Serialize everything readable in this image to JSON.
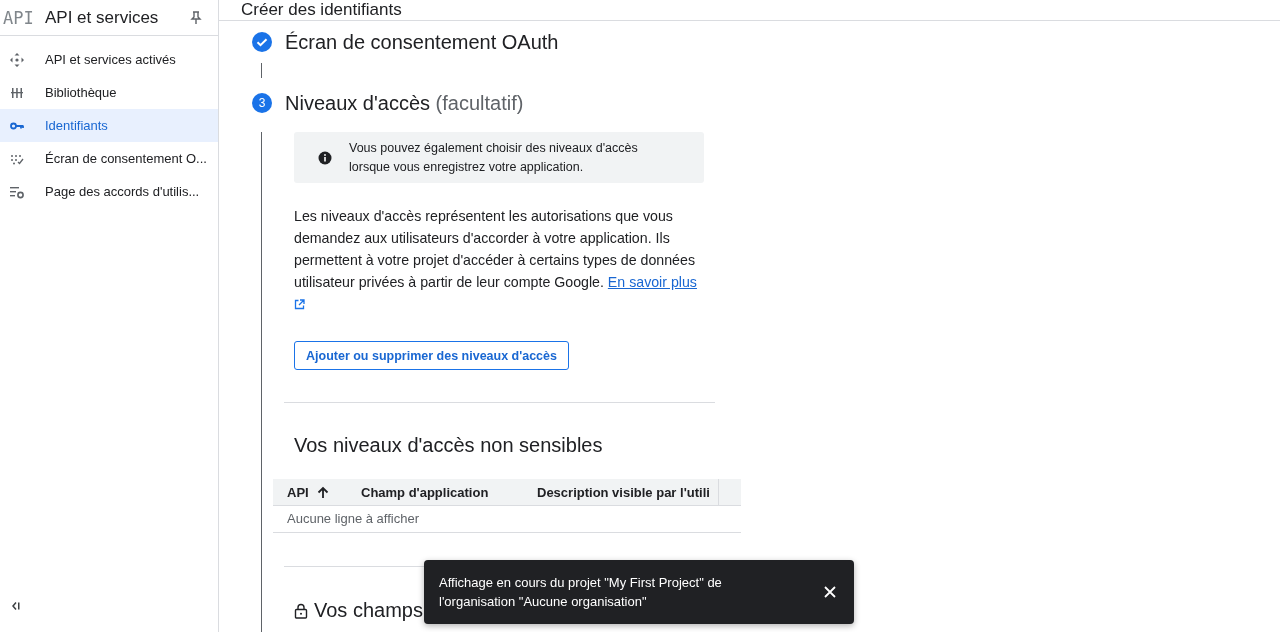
{
  "app": {
    "logo": "API",
    "title": "API et services"
  },
  "page_title": "Créer des identifiants",
  "sidebar": {
    "items": [
      {
        "label": "API et services activés",
        "kind": "move",
        "selected": false
      },
      {
        "label": "Bibliothèque",
        "kind": "library",
        "selected": false
      },
      {
        "label": "Identifiants",
        "kind": "key",
        "selected": true
      },
      {
        "label": "Écran de consentement O...",
        "kind": "consent",
        "selected": false
      },
      {
        "label": "Page des accords d'utilis...",
        "kind": "settings",
        "selected": false
      }
    ]
  },
  "steps": [
    {
      "kind": "done",
      "title": "Écran de consentement OAuth"
    },
    {
      "kind": "current",
      "number": "3",
      "title": "Niveaux d'accès",
      "note": "(facultatif)"
    }
  ],
  "info": "Vous pouvez également choisir des niveaux d'accès lorsque vous enregistrez votre application.",
  "description": "Les niveaux d'accès représentent les autorisations que vous demandez aux utilisateurs d'accorder à votre application. Ils permettent à votre projet d'accéder à certains types de données utilisateur privées à partir de leur compte Google.",
  "learn_more": "En savoir plus",
  "scopes_button": "Ajouter ou supprimer des niveaux d'accès",
  "non_sensitive": {
    "title": "Vos niveaux d'accès non sensibles",
    "columns": [
      {
        "label": "API",
        "sorted": true
      },
      {
        "label": "Champ d'application",
        "sorted": false
      },
      {
        "label": "Description visible par l'utili",
        "sorted": false
      }
    ],
    "empty": "Aucune ligne à afficher"
  },
  "sensitive": {
    "title": "Vos champs",
    "locked": true
  },
  "snackbar": {
    "message": "Affichage en cours du projet \"My First Project\" de l'organisation \"Aucune organisation\""
  }
}
